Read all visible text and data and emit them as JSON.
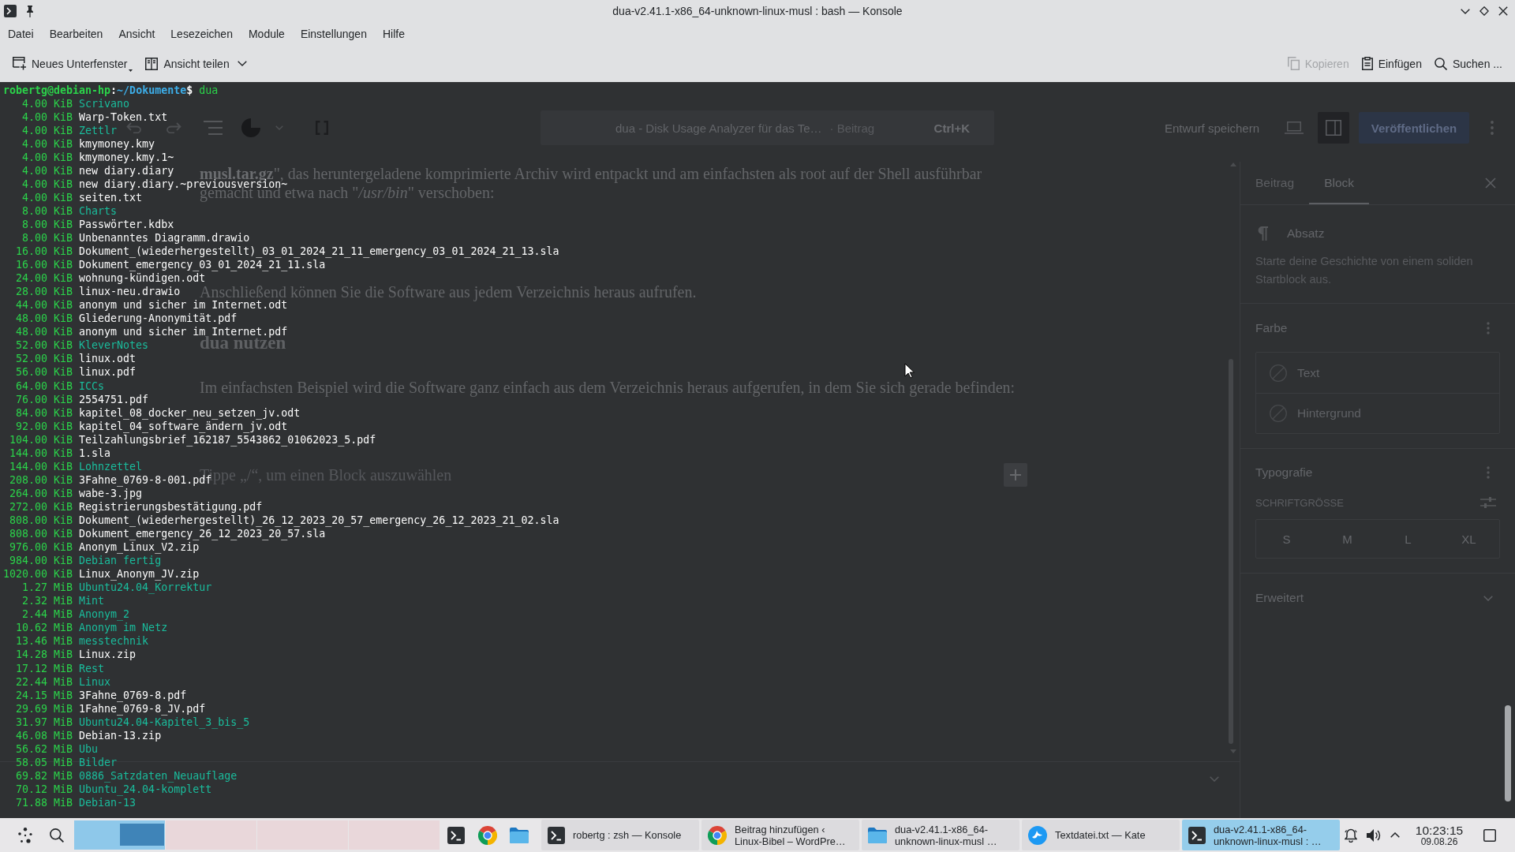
{
  "window": {
    "title": "dua-v2.41.1-x86_64-unknown-linux-musl : bash — Konsole"
  },
  "menu": [
    "Datei",
    "Bearbeiten",
    "Ansicht",
    "Lesezeichen",
    "Module",
    "Einstellungen",
    "Hilfe"
  ],
  "toolbar": {
    "left": [
      {
        "label": "Neues Unterfenster",
        "kind": "new-tab"
      },
      {
        "label": "Ansicht teilen",
        "kind": "split-view"
      }
    ],
    "right": [
      {
        "label": "Kopieren",
        "kind": "copy",
        "disabled": true
      },
      {
        "label": "Einfügen",
        "kind": "paste",
        "disabled": false
      },
      {
        "label": "Suchen ...",
        "kind": "search",
        "disabled": false
      }
    ]
  },
  "terminal": {
    "prompt": {
      "user_host": "robertg@debian-hp",
      "separator": ":",
      "path": "~/Dokumente",
      "symbol": "$"
    },
    "command": "dua",
    "entries": [
      {
        "size": "4.00 KiB",
        "name": "Scrivano",
        "kind": "directory"
      },
      {
        "size": "4.00 KiB",
        "name": "Warp-Token.txt",
        "kind": "file"
      },
      {
        "size": "4.00 KiB",
        "name": "Zettlr",
        "kind": "directory"
      },
      {
        "size": "4.00 KiB",
        "name": "kmymoney.kmy",
        "kind": "file"
      },
      {
        "size": "4.00 KiB",
        "name": "kmymoney.kmy.1~",
        "kind": "file"
      },
      {
        "size": "4.00 KiB",
        "name": "new diary.diary",
        "kind": "file"
      },
      {
        "size": "4.00 KiB",
        "name": "new diary.diary.~previousversion~",
        "kind": "file"
      },
      {
        "size": "4.00 KiB",
        "name": "seiten.txt",
        "kind": "file"
      },
      {
        "size": "8.00 KiB",
        "name": "Charts",
        "kind": "directory"
      },
      {
        "size": "8.00 KiB",
        "name": "Passwörter.kdbx",
        "kind": "file"
      },
      {
        "size": "8.00 KiB",
        "name": "Unbenanntes Diagramm.drawio",
        "kind": "file"
      },
      {
        "size": "16.00 KiB",
        "name": "Dokument_(wiederhergestellt)_03_01_2024_21_11_emergency_03_01_2024_21_13.sla",
        "kind": "file"
      },
      {
        "size": "16.00 KiB",
        "name": "Dokument_emergency_03_01_2024_21_11.sla",
        "kind": "file"
      },
      {
        "size": "24.00 KiB",
        "name": "wohnung-kündigen.odt",
        "kind": "file"
      },
      {
        "size": "28.00 KiB",
        "name": "linux-neu.drawio",
        "kind": "file"
      },
      {
        "size": "44.00 KiB",
        "name": "anonym und sicher im Internet.odt",
        "kind": "file"
      },
      {
        "size": "48.00 KiB",
        "name": "Gliederung-Anonymität.pdf",
        "kind": "file"
      },
      {
        "size": "48.00 KiB",
        "name": "anonym und sicher im Internet.pdf",
        "kind": "file"
      },
      {
        "size": "52.00 KiB",
        "name": "KleverNotes",
        "kind": "directory"
      },
      {
        "size": "52.00 KiB",
        "name": "linux.odt",
        "kind": "file"
      },
      {
        "size": "56.00 KiB",
        "name": "linux.pdf",
        "kind": "file"
      },
      {
        "size": "64.00 KiB",
        "name": "ICCs",
        "kind": "directory"
      },
      {
        "size": "76.00 KiB",
        "name": "2554751.pdf",
        "kind": "file"
      },
      {
        "size": "84.00 KiB",
        "name": "kapitel_08_docker_neu_setzen_jv.odt",
        "kind": "file"
      },
      {
        "size": "92.00 KiB",
        "name": "kapitel_04_software_ändern_jv.odt",
        "kind": "file"
      },
      {
        "size": "104.00 KiB",
        "name": "Teilzahlungsbrief_162187_5543862_01062023_5.pdf",
        "kind": "file"
      },
      {
        "size": "144.00 KiB",
        "name": "1.sla",
        "kind": "file"
      },
      {
        "size": "144.00 KiB",
        "name": "Lohnzettel",
        "kind": "directory"
      },
      {
        "size": "208.00 KiB",
        "name": "3Fahne_0769-8-001.pdf",
        "kind": "file"
      },
      {
        "size": "264.00 KiB",
        "name": "wabe-3.jpg",
        "kind": "file"
      },
      {
        "size": "272.00 KiB",
        "name": "Registrierungsbestätigung.pdf",
        "kind": "file"
      },
      {
        "size": "808.00 KiB",
        "name": "Dokument_(wiederhergestellt)_26_12_2023_20_57_emergency_26_12_2023_21_02.sla",
        "kind": "file"
      },
      {
        "size": "808.00 KiB",
        "name": "Dokument_emergency_26_12_2023_20_57.sla",
        "kind": "file"
      },
      {
        "size": "976.00 KiB",
        "name": "Anonym_Linux_V2.zip",
        "kind": "file"
      },
      {
        "size": "984.00 KiB",
        "name": "Debian fertig",
        "kind": "directory"
      },
      {
        "size": "1020.00 KiB",
        "name": "Linux_Anonym_JV.zip",
        "kind": "file"
      },
      {
        "size": "1.27 MiB",
        "name": "Ubuntu24.04_Korrektur",
        "kind": "directory"
      },
      {
        "size": "2.32 MiB",
        "name": "Mint",
        "kind": "directory"
      },
      {
        "size": "2.44 MiB",
        "name": "Anonym_2",
        "kind": "directory"
      },
      {
        "size": "10.62 MiB",
        "name": "Anonym im Netz",
        "kind": "directory"
      },
      {
        "size": "13.46 MiB",
        "name": "messtechnik",
        "kind": "directory"
      },
      {
        "size": "14.28 MiB",
        "name": "Linux.zip",
        "kind": "file"
      },
      {
        "size": "17.12 MiB",
        "name": "Rest",
        "kind": "directory"
      },
      {
        "size": "22.44 MiB",
        "name": "Linux",
        "kind": "directory"
      },
      {
        "size": "24.15 MiB",
        "name": "3Fahne_0769-8.pdf",
        "kind": "file"
      },
      {
        "size": "29.69 MiB",
        "name": "1Fahne_0769-8_JV.pdf",
        "kind": "file"
      },
      {
        "size": "31.97 MiB",
        "name": "Ubuntu24.04-Kapitel_3_bis_5",
        "kind": "directory"
      },
      {
        "size": "46.08 MiB",
        "name": "Debian-13.zip",
        "kind": "file"
      },
      {
        "size": "56.62 MiB",
        "name": "Ubu",
        "kind": "directory"
      },
      {
        "size": "58.05 MiB",
        "name": "Bilder",
        "kind": "directory"
      },
      {
        "size": "69.82 MiB",
        "name": "0886_Satzdaten_Neuauflage",
        "kind": "directory"
      },
      {
        "size": "70.12 MiB",
        "name": "Ubuntu_24.04-komplett",
        "kind": "directory"
      },
      {
        "size": "71.88 MiB",
        "name": "Debian-13",
        "kind": "directory"
      }
    ]
  },
  "background_editor": {
    "header": {
      "document_title": "dua - Disk Usage Analyzer für das Te…",
      "post_type": "· Beitrag",
      "shortcut": "Ctrl+K",
      "save_draft": "Entwurf speichern",
      "sidebar_open": true,
      "publish": "Veröffentlichen"
    },
    "blocks": [
      {
        "kind": "paragraph",
        "text": "**musl.tar.gz**\", das heruntergeladene komprimierte Archiv wird entpackt und am einfachsten als root auf der Shell ausführbar gemacht und etwa nach \"*/usr/bin*\" verschoben:"
      },
      {
        "kind": "paragraph",
        "text": "Anschließend können Sie die Software aus jedem Verzeichnis heraus aufrufen."
      },
      {
        "kind": "heading",
        "text": "dua nutzen"
      },
      {
        "kind": "paragraph",
        "text": "Im einfachsten Beispiel wird die Software ganz einfach aus dem Verzeichnis heraus aufgerufen, in dem Sie sich gerade befinden:"
      },
      {
        "kind": "empty",
        "placeholder": "Tippe „/“, um einen Block auszuwählen"
      }
    ],
    "sidebar": {
      "tabs": [
        {
          "label": "Beitrag",
          "selected": false
        },
        {
          "label": "Block",
          "selected": true
        }
      ],
      "block": {
        "name": "Absatz",
        "description": "Starte deine Geschichte von einem soliden Startblock aus."
      },
      "color": {
        "title": "Farbe",
        "items": [
          "Text",
          "Hintergrund"
        ]
      },
      "typography": {
        "title": "Typografie",
        "font_size_label": "SCHRIFTGRÖSSE",
        "sizes": [
          "S",
          "M",
          "L",
          "XL"
        ]
      },
      "advanced": {
        "title": "Erweitert",
        "expanded": false
      }
    }
  },
  "taskbar": {
    "desktops": [
      {
        "selected": true,
        "has_window": true
      },
      {
        "selected": false,
        "has_window": false
      },
      {
        "selected": false,
        "has_window": false
      },
      {
        "selected": false,
        "has_window": false
      }
    ],
    "pinned": [
      {
        "kind": "terminal"
      },
      {
        "kind": "browser"
      },
      {
        "kind": "files"
      }
    ],
    "tasks": [
      {
        "kind": "terminal",
        "lines": [
          "robertg : zsh — Konsole"
        ],
        "selected": false
      },
      {
        "kind": "browser",
        "lines": [
          "Beitrag hinzufügen ‹",
          "Linux-Bibel – WordPre…"
        ],
        "selected": false
      },
      {
        "kind": "files",
        "lines": [
          "dua-v2.41.1-x86_64-",
          "unknown-linux-musl …"
        ],
        "selected": false
      },
      {
        "kind": "editor",
        "lines": [
          "Textdatei.txt — Kate"
        ],
        "selected": false
      },
      {
        "kind": "terminal",
        "lines": [
          "dua-v2.41.1-x86_64-",
          "unknown-linux-musl : …"
        ],
        "selected": true
      }
    ],
    "clock": {
      "time": "10:23:15",
      "date": "09.08.26"
    }
  }
}
